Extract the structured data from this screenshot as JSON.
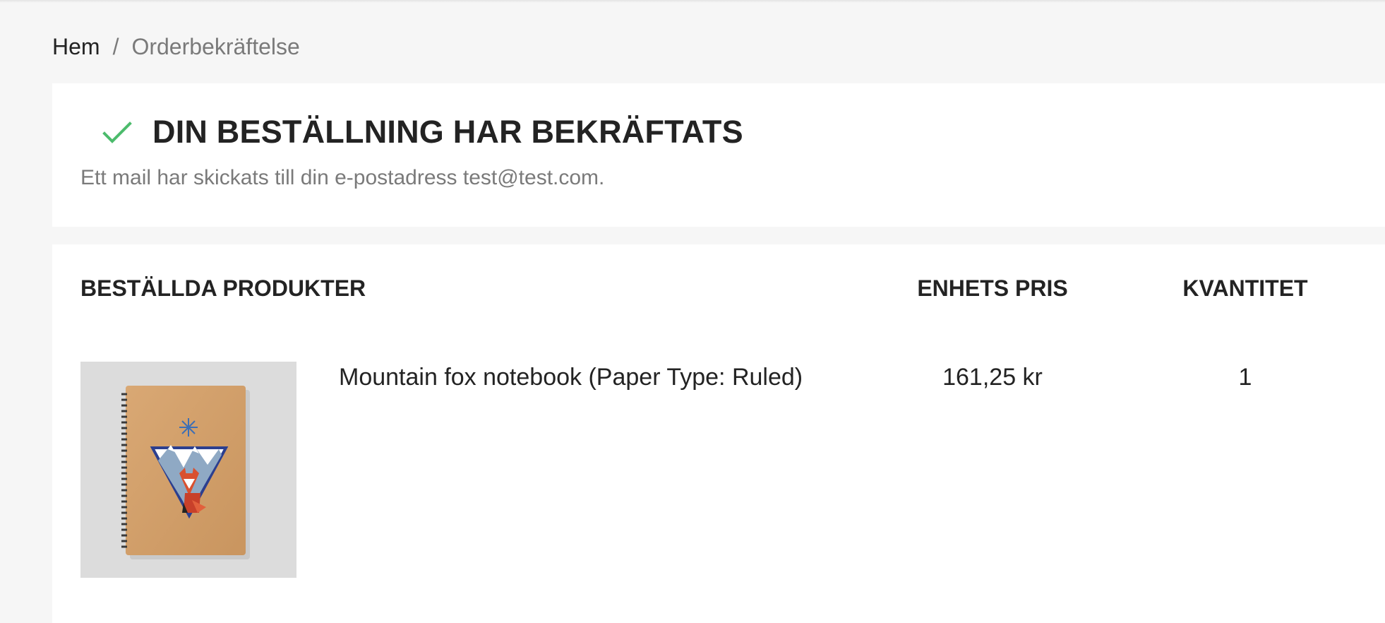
{
  "breadcrumb": {
    "home": "Hem",
    "separator": "/",
    "current": "Orderbekräftelse"
  },
  "confirmation": {
    "title": "DIN BESTÄLLNING HAR BEKRÄFTATS",
    "message": "Ett mail har skickats till din e-postadress test@test.com.",
    "icon": "check-icon",
    "icon_color": "#4cbb6c"
  },
  "products_table": {
    "headers": {
      "products": "BESTÄLLDA PRODUKTER",
      "unit_price": "ENHETS PRIS",
      "quantity": "KVANTITET"
    },
    "rows": [
      {
        "name": "Mountain fox notebook (Paper Type: Ruled)",
        "unit_price": "161,25 kr",
        "quantity": "1",
        "image": "mountain-fox-notebook-image"
      }
    ]
  }
}
